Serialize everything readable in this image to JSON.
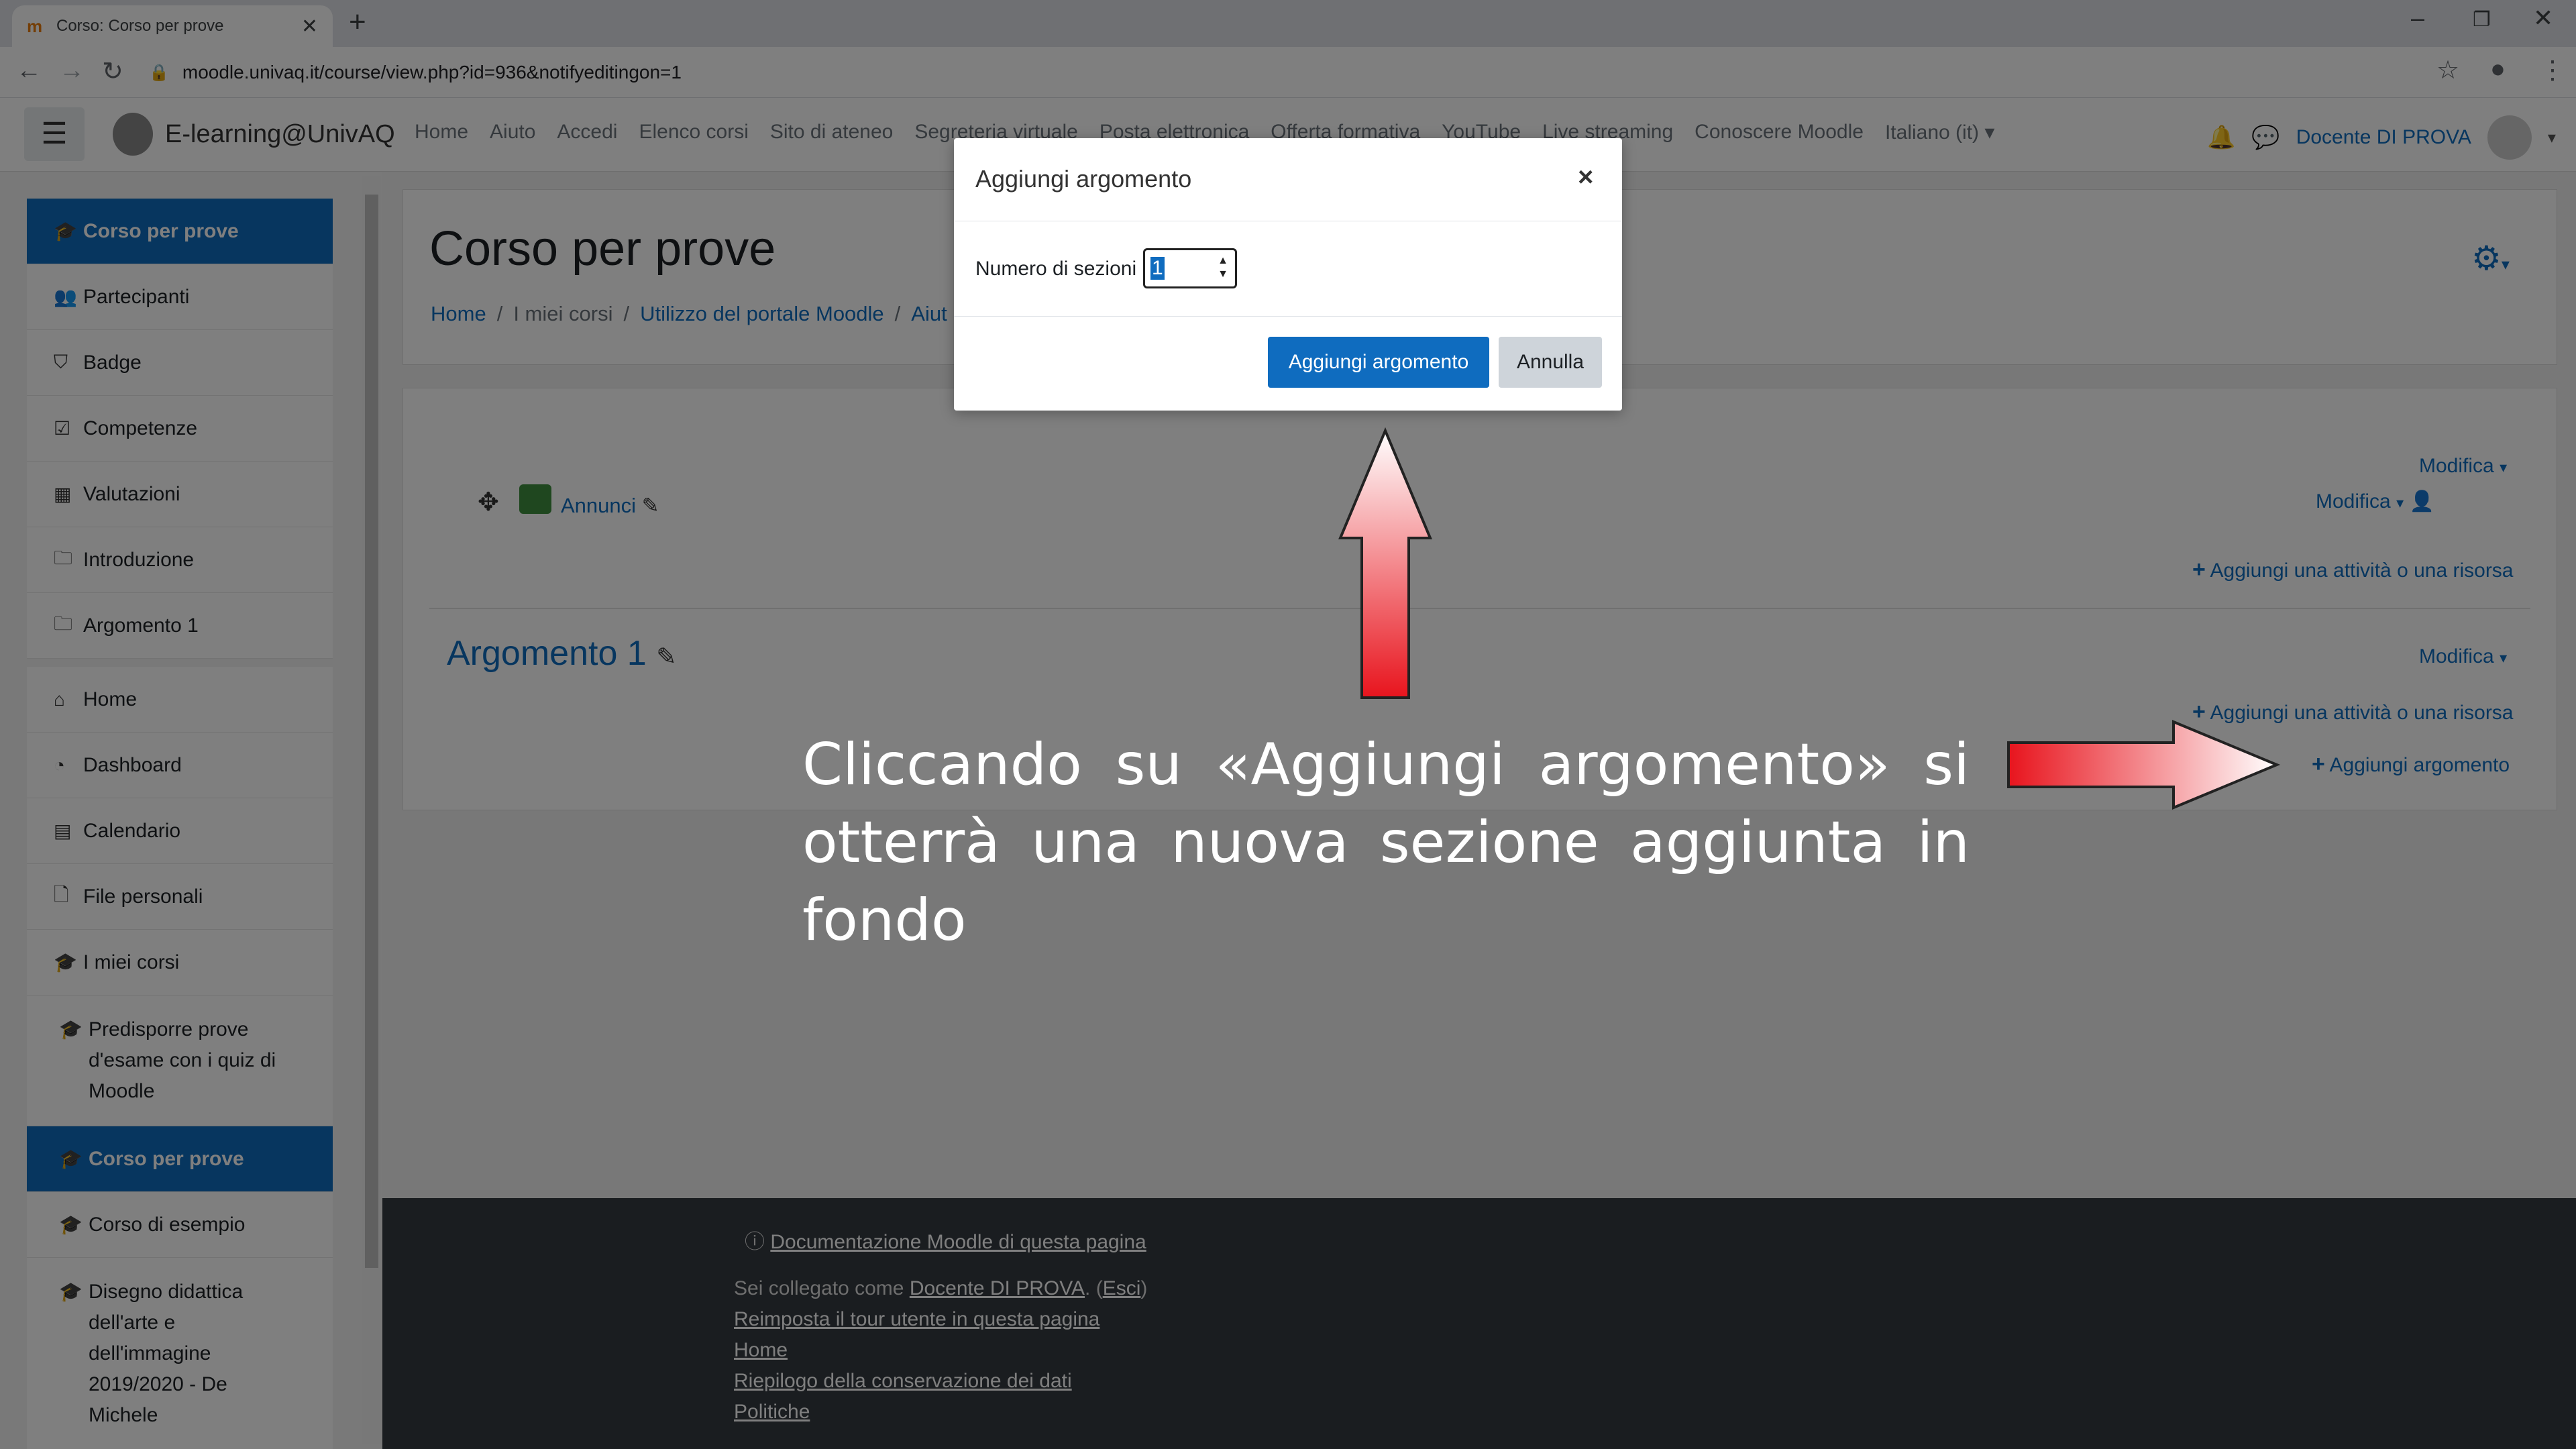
{
  "browser": {
    "tab_title": "Corso: Corso per prove",
    "tab_favicon": "m",
    "url": "moodle.univaq.it/course/view.php?id=936&notifyeditingon=1"
  },
  "navbar": {
    "brand": "E-learning@UnivAQ",
    "links": [
      "Home",
      "Aiuto",
      "Accedi",
      "Elenco corsi",
      "Sito di ateneo",
      "Segreteria virtuale",
      "Posta elettronica",
      "Offerta formativa",
      "YouTube",
      "Live streaming",
      "Conoscere Moodle"
    ],
    "language": "Italiano (it)",
    "user": "Docente DI PROVA"
  },
  "drawer": {
    "group1": [
      {
        "label": "Corso per prove",
        "icon": "graduation-cap-icon",
        "active": true
      },
      {
        "label": "Partecipanti",
        "icon": "users-icon"
      },
      {
        "label": "Badge",
        "icon": "shield-icon"
      },
      {
        "label": "Competenze",
        "icon": "check-square-icon"
      },
      {
        "label": "Valutazioni",
        "icon": "table-icon"
      },
      {
        "label": "Introduzione",
        "icon": "folder-icon"
      },
      {
        "label": "Argomento 1",
        "icon": "folder-icon"
      }
    ],
    "group2": [
      {
        "label": "Home",
        "icon": "home-icon"
      },
      {
        "label": "Dashboard",
        "icon": "dashboard-icon"
      },
      {
        "label": "Calendario",
        "icon": "calendar-icon"
      },
      {
        "label": "File personali",
        "icon": "file-icon"
      },
      {
        "label": "I miei corsi",
        "icon": "graduation-cap-icon"
      },
      {
        "label": "Predisporre prove d'esame con i quiz di Moodle",
        "icon": "graduation-cap-icon"
      },
      {
        "label": "Corso per prove",
        "icon": "graduation-cap-icon",
        "active": true
      },
      {
        "label": "Corso di esempio",
        "icon": "graduation-cap-icon"
      },
      {
        "label": "Disegno didattica dell'arte e dell'immagine 2019/2020 - De Michele",
        "icon": "graduation-cap-icon"
      }
    ]
  },
  "main": {
    "title": "Corso per prove",
    "breadcrumb": [
      "Home",
      "I miei corsi",
      "Utilizzo del portale Moodle",
      "Aiut"
    ],
    "announcements": "Annunci",
    "edit_label": "Modifica",
    "add_activity": "Aggiungi una attività o una risorsa",
    "section_title": "Argomento 1",
    "add_section": "Aggiungi argomento"
  },
  "footer": {
    "docs_link": "Documentazione Moodle di questa pagina",
    "logged_prefix": "Sei collegato come ",
    "logged_user": "Docente DI PROVA",
    "logout_prefix": ". (",
    "logout": "Esci",
    "logout_suffix": ")",
    "tour": "Reimposta il tour utente in questa pagina",
    "home": "Home",
    "retention": "Riepilogo della conservazione dei dati",
    "policies": "Politiche"
  },
  "modal": {
    "title": "Aggiungi argomento",
    "field_label": "Numero di sezioni",
    "field_value": "1",
    "confirm": "Aggiungi argomento",
    "cancel": "Annulla"
  },
  "annotation": {
    "caption": "Cliccando su «Aggiungi argomento» si otterrà una nuova sezione aggiunta in fondo"
  },
  "colors": {
    "primary": "#0f6cbf",
    "footer_bg": "#343a40",
    "arrow_red": "#e8141d"
  }
}
